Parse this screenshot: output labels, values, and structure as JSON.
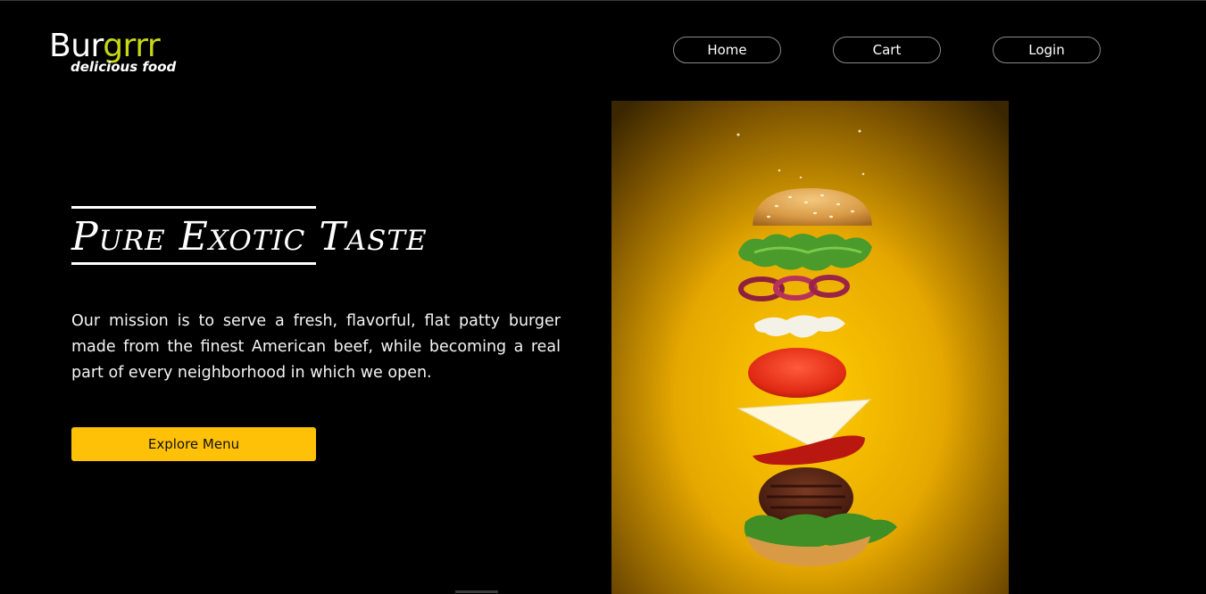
{
  "logo": {
    "main_part1": "Bur",
    "main_part2": "grrr",
    "tagline": "delicious food",
    "accent_color": "#c6d816"
  },
  "nav": {
    "items": [
      {
        "label": "Home"
      },
      {
        "label": "Cart"
      },
      {
        "label": "Login"
      }
    ]
  },
  "hero": {
    "title": "Pure Exotic Taste",
    "description": "Our mission is to serve a fresh, flavorful, flat patty burger made from the finest American beef, while becoming a real part of every neighborhood in which we open.",
    "cta_label": "Explore Menu",
    "cta_color": "#ffc107"
  },
  "image": {
    "icon": "floating-burger-photo",
    "background_color": "#f5b800"
  }
}
